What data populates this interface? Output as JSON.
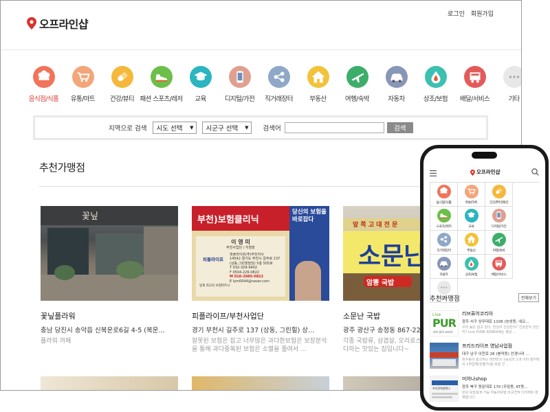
{
  "brand": {
    "name": "오프라인샵",
    "pin_color": "#d9342b"
  },
  "auth": {
    "login": "로그인",
    "signup": "회원가입"
  },
  "categories": [
    {
      "label": "음식점/식품",
      "icon": "chef-hat-icon",
      "color": "#f0745a",
      "active": true
    },
    {
      "label": "유통/마트",
      "icon": "shopping-cart-icon",
      "color": "#f2a67a",
      "active": false
    },
    {
      "label": "건강/뷰티",
      "icon": "pill-icon",
      "color": "#f5b83a",
      "active": false
    },
    {
      "label": "패션 스포츠/레저",
      "icon": "sneaker-icon",
      "color": "#6cbf4a",
      "active": false
    },
    {
      "label": "교육",
      "icon": "graduation-cap-icon",
      "color": "#2bb5c0",
      "active": false
    },
    {
      "label": "디지털/가전",
      "icon": "smartphone-icon",
      "color": "#e0a090",
      "active": false
    },
    {
      "label": "직거래장터",
      "icon": "share-nodes-icon",
      "color": "#8fa8c8",
      "active": false
    },
    {
      "label": "부동산",
      "icon": "house-icon",
      "color": "#f2c23a",
      "active": false
    },
    {
      "label": "여행/숙박",
      "icon": "airplane-icon",
      "color": "#3dae6a",
      "active": false
    },
    {
      "label": "자동차",
      "icon": "car-icon",
      "color": "#8896b8",
      "active": false
    },
    {
      "label": "상조/보험",
      "icon": "drop-icon",
      "color": "#3cc0b0",
      "active": false
    },
    {
      "label": "배달/서비스",
      "icon": "delivery-icon",
      "color": "#e45a5a",
      "active": false
    },
    {
      "label": "기타",
      "icon": "more-dots-icon",
      "color": "#e8e8e8",
      "active": false
    }
  ],
  "search": {
    "region_label": "지역으로 검색",
    "sido": "시도 선택",
    "sigungu": "시군구 선택",
    "keyword_label": "검색어",
    "keyword_value": "",
    "button": "검색"
  },
  "recommended": {
    "title": "추천가맹점",
    "cards": [
      {
        "name": "꽃닢플라워",
        "address": "충남 당진시 송악읍 신복운로6길 4-5 (복운...",
        "desc": "플라워 까페",
        "sign": "꽃닢"
      },
      {
        "name": "피플라이프/부천사업단",
        "address": "경기 부천시 길주로 137 (상동, 그린힐) 상...",
        "desc": "잘못된 보험은 잡고 너무많은 과다한보험은 보장분석을 통해 과다중복된 보험은 소멸을 줄여서 ...",
        "banner": "부천)보험클리닉",
        "banner_side": "당신의 보험을 바로잡다",
        "card_person": "이 영 미",
        "card_role": "부천사업단 / 지점장",
        "card_company": "피플라이프(주)부천지사",
        "card_address": "14542 경기도 부천시 길주로 137",
        "card_detail": "(상동,그린힐빌딩) 5층 505호",
        "card_tel": "T 032-329-9402",
        "card_fax": "F 0504-226-0822",
        "card_mobile": "M 010-2085-0822",
        "card_email": "E lym0044@naver.com",
        "card_brand": "피플라이프",
        "card_motto": "업계 최고의 보험파트너"
      },
      {
        "name": "소문난 국밥",
        "address": "광주 광산구 송정동 867-22",
        "desc": "각종 국밥류, 삼겹살, 오리로스 외 진심을 다해 최선을 다하는 맛있는 집입니다~",
        "sign_top": "앞 쪽 고 대 전 문",
        "sign": "소문난",
        "sign_bottom": "암뽕 국밥"
      }
    ]
  },
  "mobile": {
    "categories": [
      {
        "label": "음식점/식품",
        "icon": "chef-hat-icon",
        "color": "#f0745a"
      },
      {
        "label": "유통/마트",
        "icon": "shopping-cart-icon",
        "color": "#f2a67a"
      },
      {
        "label": "건강/뷰티/패션",
        "icon": "pill-icon",
        "color": "#f5b83a"
      },
      {
        "label": "스포츠/레저",
        "icon": "sneaker-icon",
        "color": "#6cbf4a"
      },
      {
        "label": "교육",
        "icon": "graduation-cap-icon",
        "color": "#2bb5c0"
      },
      {
        "label": "디지털/가전",
        "icon": "smartphone-icon",
        "color": "#e0a090"
      },
      {
        "label": "직거래장터",
        "icon": "share-nodes-icon",
        "color": "#8fa8c8"
      },
      {
        "label": "부동산",
        "icon": "house-icon",
        "color": "#f2c23a"
      },
      {
        "label": "여행/숙박",
        "icon": "airplane-icon",
        "color": "#3dae6a"
      },
      {
        "label": "자동차",
        "icon": "car-icon",
        "color": "#8896b8"
      },
      {
        "label": "상조/보험",
        "icon": "drop-icon",
        "color": "#3cc0b0"
      },
      {
        "label": "배달/서비스",
        "icon": "delivery-icon",
        "color": "#e45a5a"
      },
      {
        "label": "기타",
        "icon": "more-dots-icon",
        "color": "#e8e8e8"
      }
    ],
    "rec_title": "추천가맹점",
    "more": "전체보기",
    "items": [
      {
        "name": "리브퓨어코리아",
        "address": "광주 서구 상무대로 1106 (농성동, 네오...",
        "desc": "우리 몸은 알고 있다. 맛있어 건강한지? 건강한지 것인지? Live PURE KOREA에는 항상 ...",
        "logo_small": "Live",
        "logo": "PUR",
        "logo_sub": "리브 퓨어 코리아"
      },
      {
        "name": "프리드라이프 영남사업점",
        "address": "대구 남구 이천로 26 (봉덕동) 안경나라 ...",
        "desc": "최수종이 광고하는 대한민국 1등상조 1.8 이라 말어택의 1위업체(한물가)을 보험 군 ..."
      },
      {
        "name": "미어나shop",
        "address": "광주 북구 동문대로 170 (우암동, KT동...",
        "desc": "원보 보험설계 가능 자동차보험 비교견적 다이렉트 판매합니다.",
        "logo_text": "프리랑에영밴나"
      }
    ]
  }
}
